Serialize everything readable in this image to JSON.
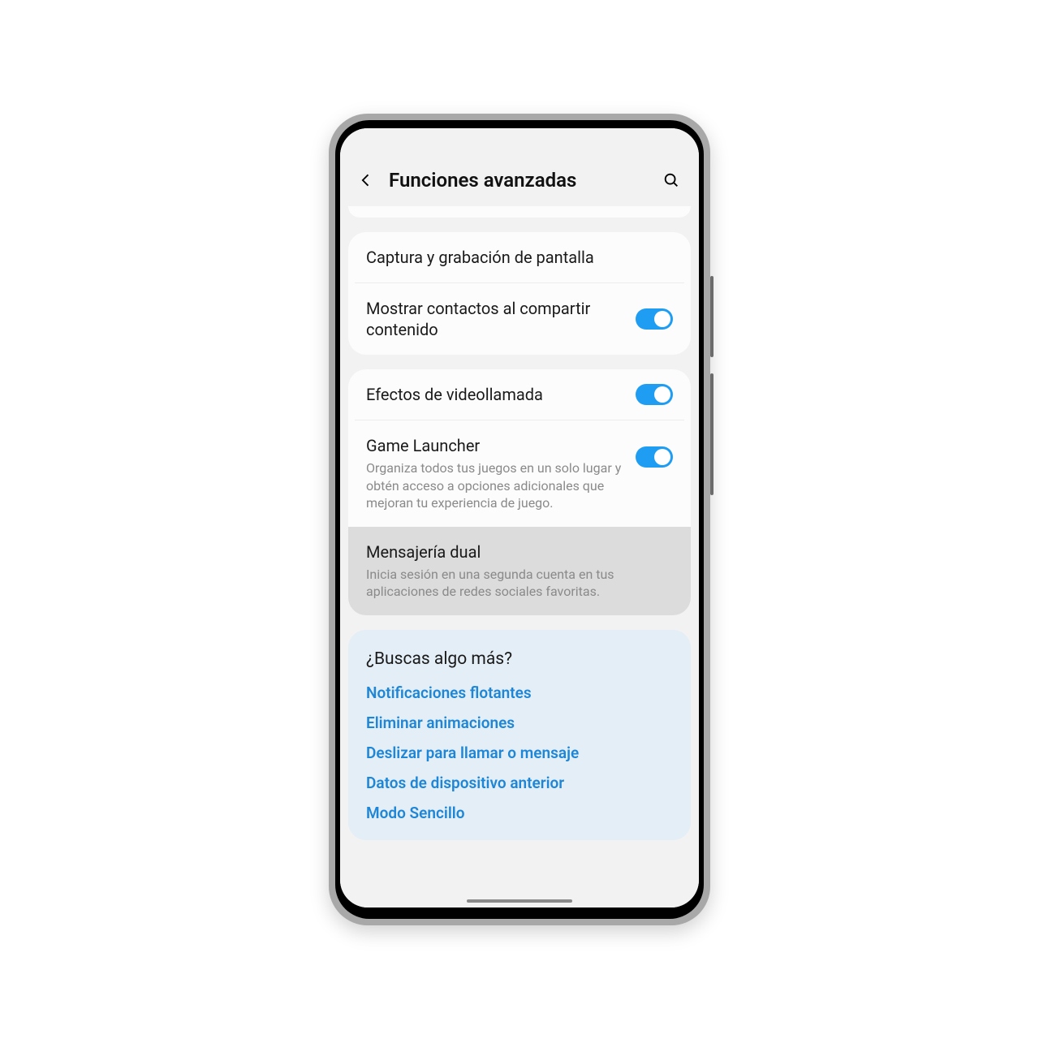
{
  "header": {
    "title": "Funciones avanzadas"
  },
  "group1": {
    "screenCapture": {
      "title": "Captura y grabación de pantalla"
    },
    "showContacts": {
      "title": "Mostrar contactos al compartir contenido",
      "toggle": true
    }
  },
  "group2": {
    "videoEffects": {
      "title": "Efectos de videollamada",
      "toggle": true
    },
    "gameLauncher": {
      "title": "Game Launcher",
      "desc": "Organiza todos tus juegos en un solo lugar y obtén acceso a opciones adicionales que mejoran tu experiencia de juego.",
      "toggle": true
    },
    "dualMessenger": {
      "title": "Mensajería dual",
      "desc": "Inicia sesión en una segunda cuenta en tus aplicaciones de redes sociales favoritas."
    }
  },
  "more": {
    "heading": "¿Buscas algo más?",
    "links": [
      "Notificaciones flotantes",
      "Eliminar animaciones",
      "Deslizar para llamar o mensaje",
      "Datos de dispositivo anterior",
      "Modo Sencillo"
    ]
  }
}
